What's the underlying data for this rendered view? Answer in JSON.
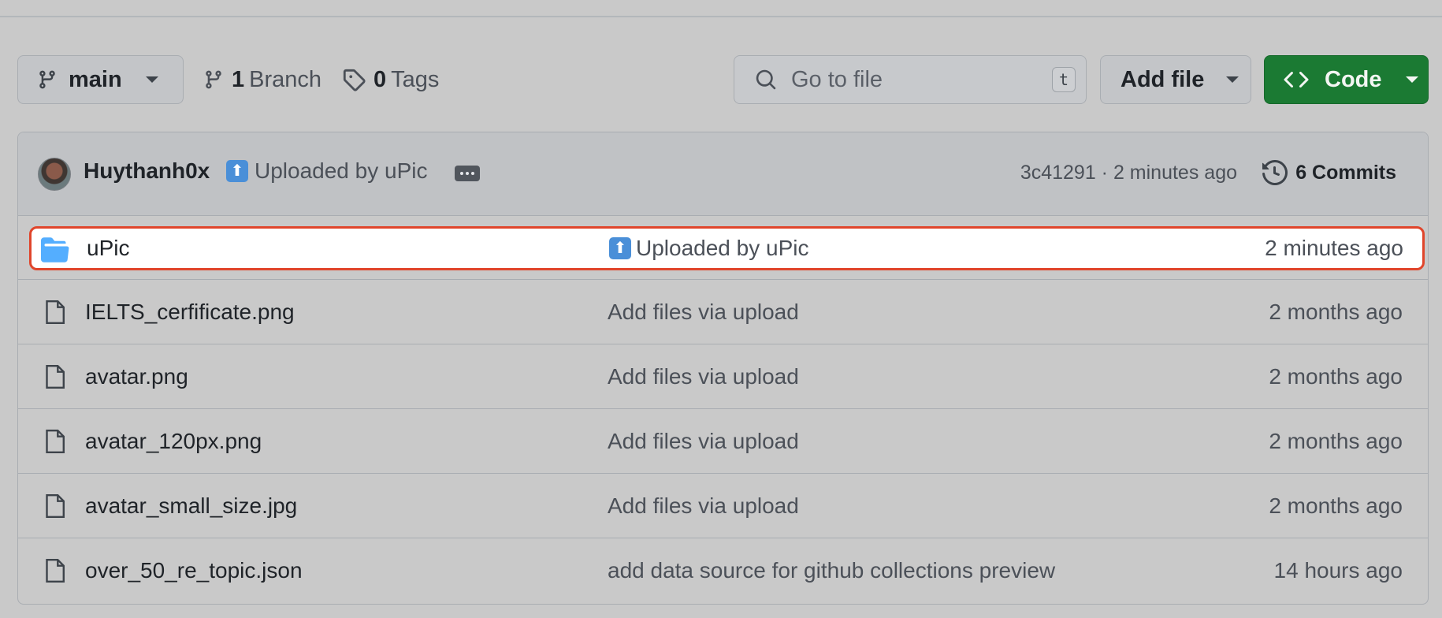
{
  "toolbar": {
    "branch": "main",
    "branches_count": "1",
    "branches_label": "Branch",
    "tags_count": "0",
    "tags_label": "Tags",
    "search_placeholder": "Go to file",
    "search_shortcut": "t",
    "add_file_label": "Add file",
    "code_label": "Code"
  },
  "latest_commit": {
    "author": "Huythanh0x",
    "message": "Uploaded by uPic",
    "emoji": "⬆",
    "meta": "3c41291 · 2 minutes ago",
    "commits_label": "6 Commits"
  },
  "files": [
    {
      "name": "uPic",
      "type": "folder",
      "message": "Uploaded by uPic",
      "emoji": "⬆",
      "age": "2 minutes ago",
      "highlighted": true
    },
    {
      "name": "IELTS_cerfificate.png",
      "type": "file",
      "message": "Add files via upload",
      "age": "2 months ago"
    },
    {
      "name": "avatar.png",
      "type": "file",
      "message": "Add files via upload",
      "age": "2 months ago"
    },
    {
      "name": "avatar_120px.png",
      "type": "file",
      "message": "Add files via upload",
      "age": "2 months ago"
    },
    {
      "name": "avatar_small_size.jpg",
      "type": "file",
      "message": "Add files via upload",
      "age": "2 months ago"
    },
    {
      "name": "over_50_re_topic.json",
      "type": "file",
      "message": "add data source for github collections preview",
      "age": "14 hours ago"
    }
  ],
  "colors": {
    "accent_code_button": "#1b7a33",
    "highlight_border": "#e0452b",
    "folder_icon": "#54aeff"
  }
}
